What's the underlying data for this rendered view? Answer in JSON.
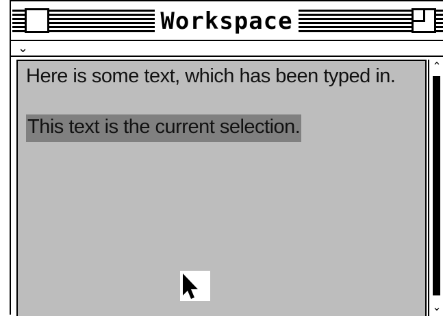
{
  "window": {
    "title": "Workspace"
  },
  "content": {
    "paragraph_1": "Here is some text, which has been typed in.",
    "selection_text": "This text is the current selection."
  },
  "icons": {
    "close": "close-box-icon",
    "zoom": "zoom-box-icon",
    "collapse": "chevron-down-icon",
    "scroll_up": "scroll-up-arrow-icon",
    "scroll_down": "scroll-down-arrow-icon",
    "cursor": "mouse-pointer-icon"
  },
  "colors": {
    "content_background": "#bdbdbd",
    "selection_highlight": "#808080"
  }
}
